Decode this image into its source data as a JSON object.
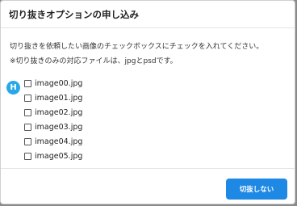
{
  "dialog": {
    "title": "切り抜きオプションの申し込み",
    "instructions": "切り抜きを依頼したい画像のチェックボックスにチェックを入れてください。",
    "note": "※切り抜きのみの対応ファイルは、jpgとpsdです。",
    "badge_letter": "H",
    "files": [
      {
        "name": "image00.jpg",
        "checked": false
      },
      {
        "name": "image01.jpg",
        "checked": false
      },
      {
        "name": "image02.jpg",
        "checked": false
      },
      {
        "name": "image03.jpg",
        "checked": false
      },
      {
        "name": "image04.jpg",
        "checked": false
      },
      {
        "name": "image05.jpg",
        "checked": false
      }
    ],
    "primary_button_label": "切抜しない"
  },
  "colors": {
    "accent": "#1e88e5",
    "badge": "#29a8e8",
    "backdrop": "#8a8a8a"
  }
}
